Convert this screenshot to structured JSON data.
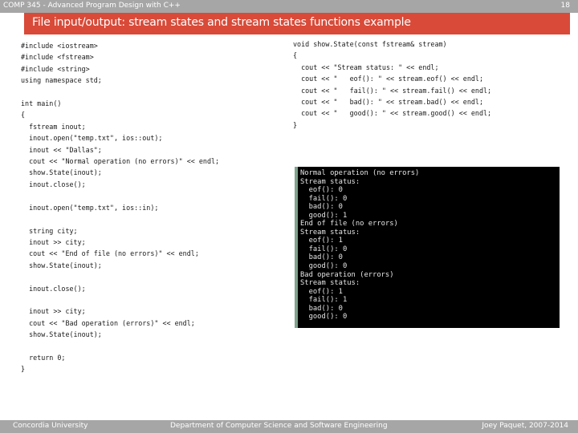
{
  "header": {
    "course": "COMP 345 - Advanced Program Design with C++",
    "page_number": "18"
  },
  "slide": {
    "title": "File input/output: stream states and stream states functions example"
  },
  "code_left": "#include <iostream>\n#include <fstream>\n#include <string>\nusing namespace std;\n\nint main()\n{\n  fstream inout;\n  inout.open(\"temp.txt\", ios::out);\n  inout << \"Dallas\";\n  cout << \"Normal operation (no errors)\" << endl;\n  show.State(inout);\n  inout.close();\n\n  inout.open(\"temp.txt\", ios::in);\n\n  string city;\n  inout >> city;\n  cout << \"End of file (no errors)\" << endl;\n  show.State(inout);\n\n  inout.close();\n\n  inout >> city;\n  cout << \"Bad operation (errors)\" << endl;\n  show.State(inout);\n\n  return 0;\n}",
  "code_right": "void show.State(const fstream& stream)\n{\n  cout << \"Stream status: \" << endl;\n  cout << \"   eof(): \" << stream.eof() << endl;\n  cout << \"   fail(): \" << stream.fail() << endl;\n  cout << \"   bad(): \" << stream.bad() << endl;\n  cout << \"   good(): \" << stream.good() << endl;\n}",
  "console_output": "Normal operation (no errors)\nStream status:\n  eof(): 0\n  fail(): 0\n  bad(): 0\n  good(): 1\nEnd of file (no errors)\nStream status:\n  eof(): 1\n  fail(): 0\n  bad(): 0\n  good(): 0\nBad operation (errors)\nStream status:\n  eof(): 1\n  fail(): 1\n  bad(): 0\n  good(): 0",
  "footer": {
    "left": "Concordia University",
    "center": "Department of Computer Science and Software Engineering",
    "right": "Joey Paquet, 2007-2014"
  }
}
